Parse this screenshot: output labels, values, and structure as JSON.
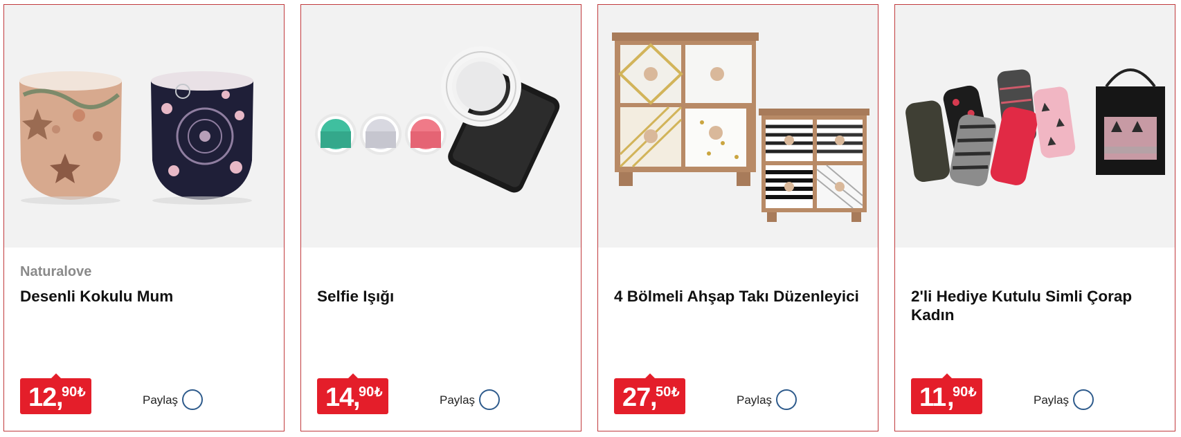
{
  "products": [
    {
      "brand": "Naturalove",
      "title": "Desenli Kokulu Mum",
      "price_int": "12",
      "price_dec": "90",
      "currency": "₺",
      "share_label": "Paylaş",
      "image_icon": "candles-image"
    },
    {
      "brand": "",
      "title": "Selfie Işığı",
      "price_int": "14",
      "price_dec": "90",
      "currency": "₺",
      "share_label": "Paylaş",
      "image_icon": "selfie-ring-light-image"
    },
    {
      "brand": "",
      "title": "4 Bölmeli Ahşap Takı Düzenleyici",
      "price_int": "27",
      "price_dec": "50",
      "currency": "₺",
      "share_label": "Paylaş",
      "image_icon": "jewelry-organizer-image"
    },
    {
      "brand": "",
      "title": "2'li Hediye Kutulu Simli Çorap Kadın",
      "price_int": "11",
      "price_dec": "90",
      "currency": "₺",
      "share_label": "Paylaş",
      "image_icon": "socks-gift-box-image"
    }
  ],
  "colors": {
    "card_border": "#c0393c",
    "price_badge": "#e41e2a",
    "share_circle": "#2e5b8c",
    "image_bg": "#f2f2f2"
  }
}
